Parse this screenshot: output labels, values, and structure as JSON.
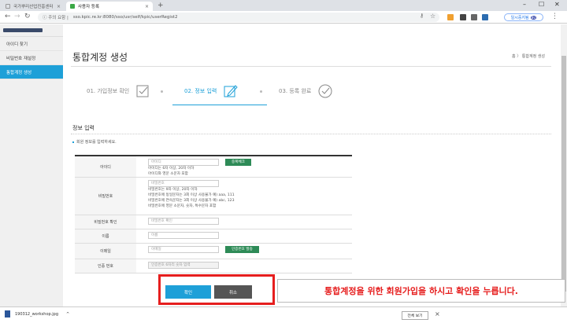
{
  "browser": {
    "tabs": [
      {
        "title": "국가뿌리산업진흥센터",
        "active": false
      },
      {
        "title": "사용자 등록",
        "active": true
      }
    ],
    "security_label": "주의 요함",
    "url": "sso.kpic.re.kr:8080/sso/usr/self/kpic/userRegist2",
    "paused_label": "일시중지됨",
    "paused_badge": "BU"
  },
  "sidebar": {
    "items": [
      {
        "label": "아이디 찾기",
        "active": false
      },
      {
        "label": "비밀번호 재설정",
        "active": false
      },
      {
        "label": "통합계정 생성",
        "active": true
      }
    ]
  },
  "page": {
    "title": "통합계정 생성",
    "breadcrumb": "홈 〉 통합계정 생성"
  },
  "steps": [
    {
      "label": "01. 가입정보 확인",
      "icon": "checkbox-icon",
      "current": false
    },
    {
      "label": "02. 정보 입력",
      "icon": "edit-icon",
      "current": true
    },
    {
      "label": "03. 등록 완료",
      "icon": "check-circle-icon",
      "current": false
    }
  ],
  "section": {
    "title": "정보 입력",
    "note": "회원 정보를 입력하세요."
  },
  "form": {
    "id": {
      "label": "아이디",
      "placeholder": "아이디",
      "button": "중복체크",
      "hints": [
        "아이디는 6자 이상, 20자 이하",
        "아이디와 영문 소문자 포함"
      ]
    },
    "password": {
      "label": "비밀번호",
      "placeholder": "비밀번호",
      "hints": [
        "비밀번호는 9자 이상, 20자 이하",
        "비밀번호에 동일문자는 3회 이상 사용불가 예) aaa, 111",
        "비밀번호에 연속문자는 3회 이상 사용불가 예) abc, 123",
        "비밀번호에 영문 소문자, 숫자, 특수문자 포함"
      ]
    },
    "password_confirm": {
      "label": "비밀번호 확인",
      "placeholder": "비밀번호 확인"
    },
    "name": {
      "label": "이름",
      "placeholder": "이름"
    },
    "email": {
      "label": "이메일",
      "placeholder": "이메일",
      "button": "인증번호 발송"
    },
    "auth": {
      "label": "인증 번호",
      "placeholder": "인증번호 6자리 숫자 입력"
    }
  },
  "buttons": {
    "confirm": "확인",
    "cancel": "취소"
  },
  "annotation": "통합계정을 위한 회원가입을 하시고 확인을 누릅니다.",
  "download": {
    "filename": "190312_workshop.jpg",
    "show_all": "전체 보기"
  },
  "colors": {
    "accent": "#1ea0d8",
    "green_button": "#2e8b57",
    "highlight": "#e61e1e"
  }
}
